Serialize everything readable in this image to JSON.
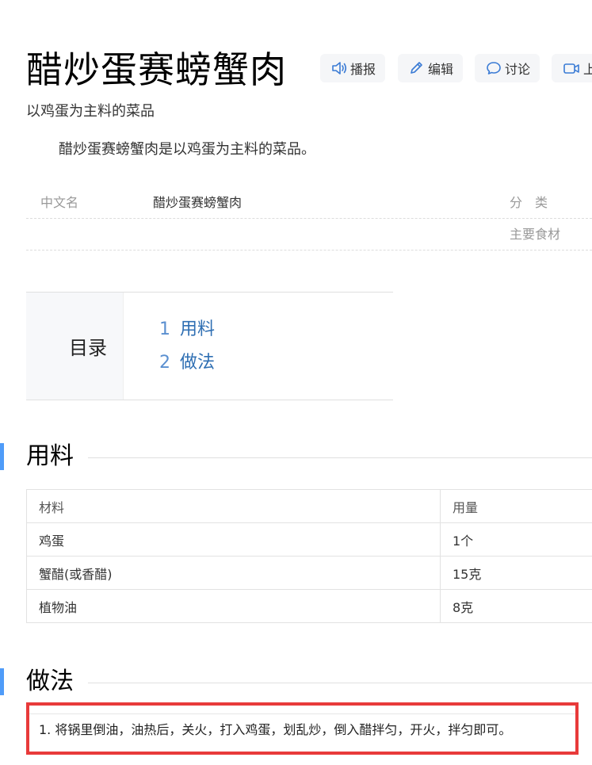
{
  "header": {
    "title": "醋炒蛋赛螃蟹肉",
    "buttons": [
      {
        "label": "播报",
        "icon": "speaker-icon"
      },
      {
        "label": "编辑",
        "icon": "pencil-icon"
      },
      {
        "label": "讨论",
        "icon": "chat-bubble-icon"
      },
      {
        "label": "上",
        "icon": "video-icon"
      }
    ],
    "subtitle": "以鸡蛋为主料的菜品"
  },
  "summary": "醋炒蛋赛螃蟹肉是以鸡蛋为主料的菜品。",
  "basic_info": {
    "rows": [
      {
        "label": "中文名",
        "value": "醋炒蛋赛螃蟹肉",
        "right_label": "分　类"
      },
      {
        "label": "",
        "value": "",
        "right_label": "主要食材"
      }
    ]
  },
  "catalog": {
    "heading": "目录",
    "items": [
      {
        "num": "1",
        "label": "用料"
      },
      {
        "num": "2",
        "label": "做法"
      }
    ]
  },
  "ingredients": {
    "section_title": "用料",
    "headers": [
      "材料",
      "用量"
    ],
    "rows": [
      [
        "鸡蛋",
        "1个"
      ],
      [
        "蟹醋(或香醋)",
        "15克"
      ],
      [
        "植物油",
        "8克"
      ]
    ]
  },
  "method": {
    "section_title": "做法",
    "steps": [
      "1. 将锅里倒油，油热后，关火，打入鸡蛋，划乱炒，倒入醋拌匀，开火，拌匀即可。"
    ]
  },
  "colors": {
    "accent_bar": "#4f9cf9",
    "link": "#2f6fb3",
    "highlight_border": "#e83a3a",
    "button_bg": "#f5f6f8"
  }
}
